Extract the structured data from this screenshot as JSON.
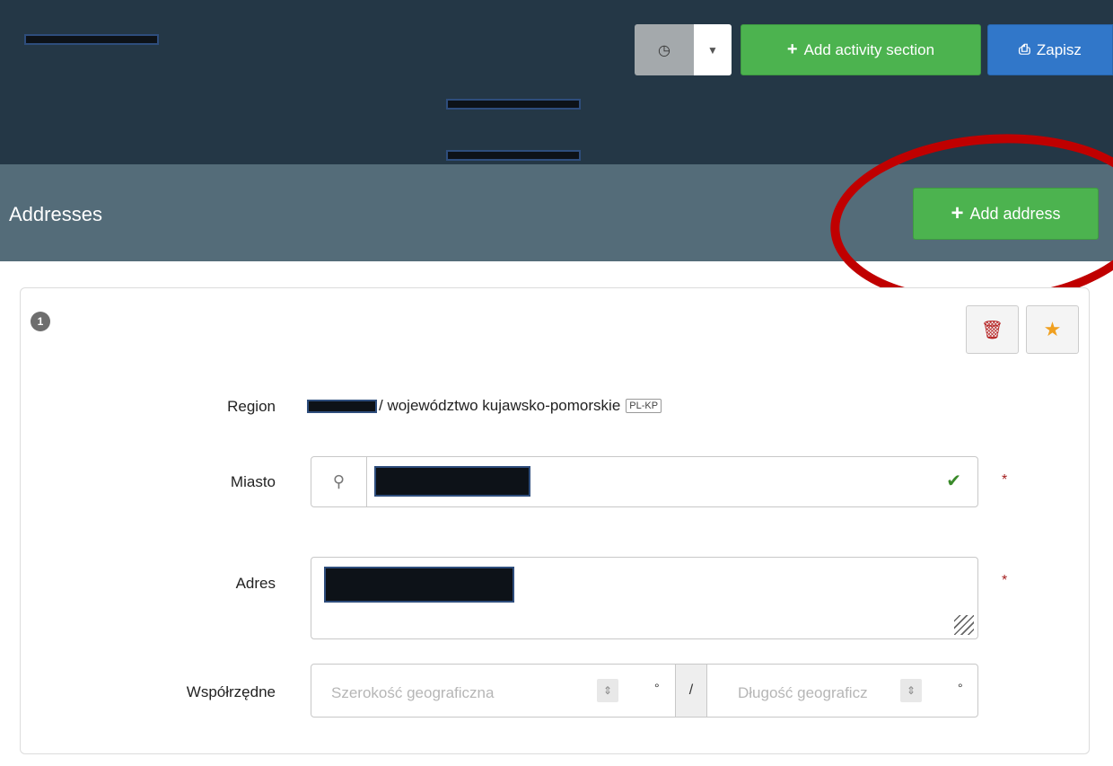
{
  "toolbar": {
    "history_icon": "clock-icon",
    "caret_icon": "caret-down-icon",
    "add_activity_label": "Add activity section",
    "save_label": "Zapisz",
    "accent_green": "#4cb34f",
    "accent_blue": "#3177c9"
  },
  "section": {
    "title": "Addresses",
    "add_address_label": "Add address"
  },
  "address": {
    "index": "1",
    "region_label": "Region",
    "region_value": "/ województwo kujawsko-pomorskie",
    "region_code": "PL-KP",
    "city_label": "Miasto",
    "address_label": "Adres",
    "coords_label": "Współrzędne",
    "lat_placeholder": "Szerokość geograficzna",
    "lon_placeholder": "Długość geograficz",
    "degree_symbol": "°",
    "separator": "/",
    "required_mark": "*"
  }
}
